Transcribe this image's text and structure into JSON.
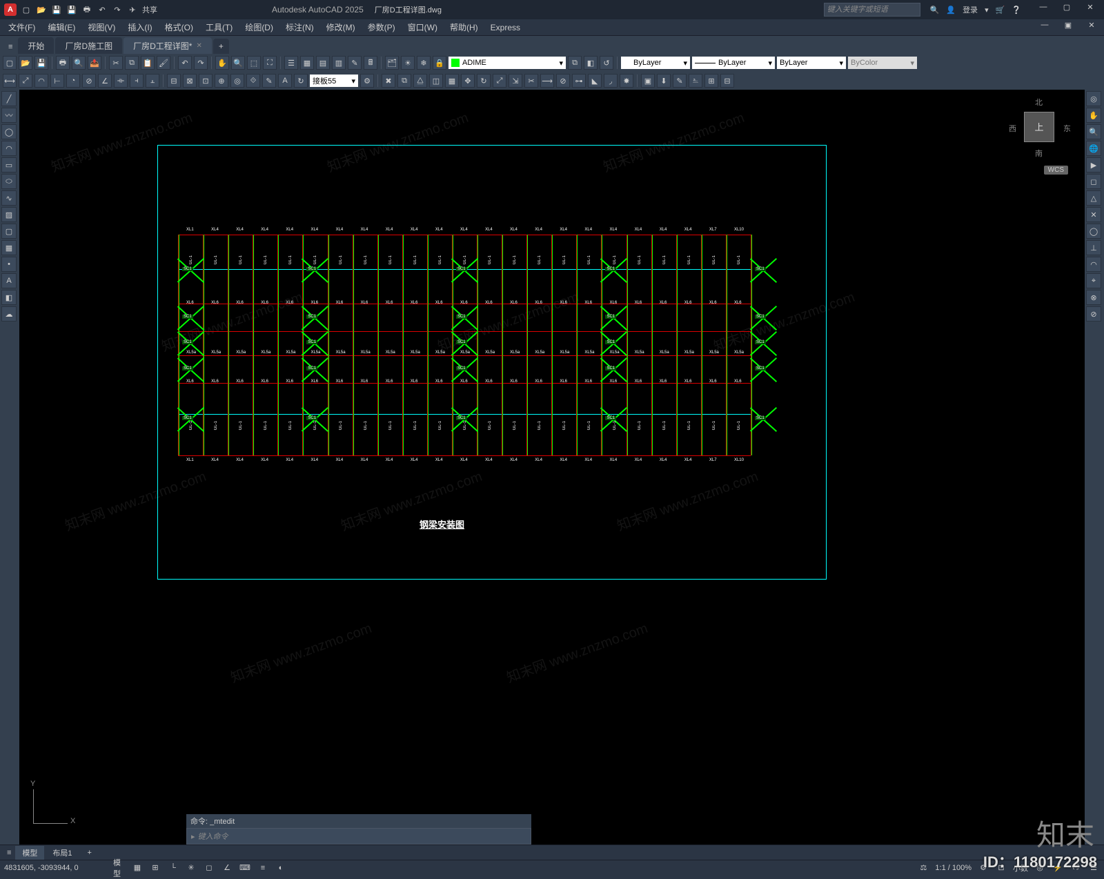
{
  "titlebar": {
    "app_letter": "A",
    "share": "共享",
    "app_title": "Autodesk AutoCAD 2025",
    "filename": "厂房D工程详图.dwg",
    "search_placeholder": "键入关键字或短语",
    "login": "登录"
  },
  "menus": [
    "文件(F)",
    "编辑(E)",
    "视图(V)",
    "插入(I)",
    "格式(O)",
    "工具(T)",
    "绘图(D)",
    "标注(N)",
    "修改(M)",
    "参数(P)",
    "窗口(W)",
    "帮助(H)",
    "Express"
  ],
  "doc_tabs": [
    {
      "label": "开始",
      "active": false
    },
    {
      "label": "厂房D施工图",
      "active": false
    },
    {
      "label": "厂房D工程详图*",
      "active": true
    }
  ],
  "layer_panel": {
    "current": "ADIME",
    "swatch": "#00ff00"
  },
  "props": {
    "color": "ByLayer",
    "linetype": "ByLayer",
    "lineweight": "ByLayer",
    "plotstyle": "ByColor"
  },
  "dim_style": "接板55",
  "viewcube": {
    "top": "上",
    "n": "北",
    "s": "南",
    "e": "东",
    "w": "西"
  },
  "drawing": {
    "title": "钢梁安装图",
    "wcs": "WCS",
    "top_labels": [
      "XL1",
      "XL4",
      "XL4",
      "XL4",
      "XL4",
      "XL4",
      "XL4",
      "XL4",
      "XL4",
      "XL4",
      "XL4",
      "XL4",
      "XL4",
      "XL4",
      "XL4",
      "XL4",
      "XL4",
      "XL4",
      "XL4",
      "XL4",
      "XL4",
      "XL7",
      "XL10"
    ],
    "bot_labels": [
      "XL1",
      "XL4",
      "XL4",
      "XL4",
      "XL4",
      "XL4",
      "XL4",
      "XL4",
      "XL4",
      "XL4",
      "XL4",
      "XL4",
      "XL4",
      "XL4",
      "XL4",
      "XL4",
      "XL4",
      "XL4",
      "XL4",
      "XL4",
      "XL4",
      "XL7",
      "XL10"
    ],
    "mid_row_label": "XL6",
    "mid_row_label2": "XL5a",
    "sc_label": "SC1",
    "gl_label": "GL-1"
  },
  "ucs": {
    "x": "X",
    "y": "Y"
  },
  "cmd": {
    "history": "命令: _mtedit",
    "prompt": "键入命令",
    "arrow": "▸"
  },
  "layout_tabs": [
    {
      "label": "模型",
      "active": true
    },
    {
      "label": "布局1",
      "active": false
    }
  ],
  "status": {
    "coords": "4831605, -3093944, 0",
    "space": "模型",
    "scale": "1:1 / 100%",
    "decimal": "小数",
    "ortho": "正交"
  },
  "watermark": {
    "id": "ID：1180172298",
    "logo": "知末",
    "url": "知末网 www.znzmo.com"
  }
}
